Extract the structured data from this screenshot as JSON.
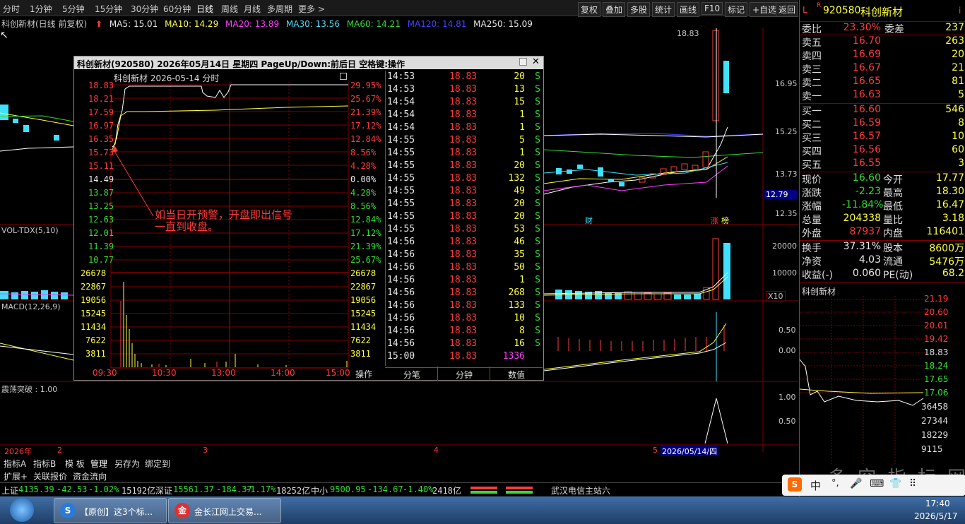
{
  "menu": {
    "periods": [
      "分时",
      "1分钟",
      "5分钟",
      "15分钟",
      "30分钟",
      "60分钟",
      "日线",
      "周线",
      "月线",
      "多周期",
      "更多 >"
    ],
    "right_buttons": [
      "复权",
      "叠加",
      "多股",
      "统计",
      "画线",
      "F10",
      "标记",
      "+自选",
      "返回"
    ]
  },
  "chart_header": {
    "title": "科创新材(日线 前复权)",
    "ma": [
      {
        "label": "MA5: 15.01",
        "color": "#ffffff"
      },
      {
        "label": "MA10: 14.29",
        "color": "#ffff40"
      },
      {
        "label": "MA20: 13.89",
        "color": "#ff40ff"
      },
      {
        "label": "MA30: 13.56",
        "color": "#40e0ff"
      },
      {
        "label": "MA60: 14.21",
        "color": "#33dd33"
      },
      {
        "label": "MA120: 14.81",
        "color": "#4444ff"
      },
      {
        "label": "MA250: 15.09",
        "color": "#ffffff"
      }
    ]
  },
  "kline": {
    "high_label": "18.83",
    "y_labels": [
      "16.95",
      "15.25",
      "13.73",
      "12.35"
    ],
    "current_price_tag": "12.79",
    "marker_cai": "财",
    "marker_zhangting": "涨",
    "marker_bang": "榜"
  },
  "vol_panel": {
    "title": "VOL-TDX(5,10)",
    "y_labels": [
      "20000",
      "10000"
    ],
    "unit": "X10"
  },
  "macd_panel": {
    "title": "MACD(12,26,9)",
    "y_labels": [
      "0.50",
      "0.00"
    ]
  },
  "osc_panel": {
    "title": "震荡突破 : 1.00",
    "y_labels": [
      "1.00",
      "0.50"
    ]
  },
  "timeline": {
    "year": "2026年",
    "months": [
      "2",
      "3",
      "4",
      "5"
    ],
    "date_tag": "2026/05/14/四"
  },
  "popup": {
    "title": "科创新材(920580)  2026年05月14日 星期四 PageUp/Down:前后日 空格键:操作",
    "sub_title": "科创新材  2026-05-14 分时",
    "prices": [
      "18.83",
      "18.21",
      "17.59",
      "16.97",
      "16.35",
      "15.73",
      "15.11",
      "14.49",
      "13.87",
      "13.25",
      "12.63",
      "12.01",
      "11.39",
      "10.77"
    ],
    "pcts": [
      "29.95%",
      "25.67%",
      "21.39%",
      "17.12%",
      "12.84%",
      "8.56%",
      "4.28%",
      "0.00%",
      "4.28%",
      "8.56%",
      "12.84%",
      "17.12%",
      "21.39%",
      "25.67%"
    ],
    "vols": [
      "26678",
      "22867",
      "19056",
      "15245",
      "11434",
      "7622",
      "3811"
    ],
    "times": [
      "09:30",
      "10:30",
      "13:00",
      "14:00",
      "15:00"
    ],
    "op_label": "操作",
    "annotation": "如当日开预警，开盘即出信号\n一直到收盘。",
    "ticks": [
      {
        "t": "14:53",
        "p": "18.83",
        "v": "20",
        "s": "S"
      },
      {
        "t": "14:53",
        "p": "18.83",
        "v": "13",
        "s": "S"
      },
      {
        "t": "14:54",
        "p": "18.83",
        "v": "15",
        "s": "S"
      },
      {
        "t": "14:54",
        "p": "18.83",
        "v": "1",
        "s": "S"
      },
      {
        "t": "14:54",
        "p": "18.83",
        "v": "1",
        "s": "S"
      },
      {
        "t": "14:55",
        "p": "18.83",
        "v": "5",
        "s": "S"
      },
      {
        "t": "14:55",
        "p": "18.83",
        "v": "1",
        "s": "S"
      },
      {
        "t": "14:55",
        "p": "18.83",
        "v": "20",
        "s": "S"
      },
      {
        "t": "14:55",
        "p": "18.83",
        "v": "132",
        "s": "S"
      },
      {
        "t": "14:55",
        "p": "18.83",
        "v": "49",
        "s": "S"
      },
      {
        "t": "14:55",
        "p": "18.83",
        "v": "20",
        "s": "S"
      },
      {
        "t": "14:55",
        "p": "18.83",
        "v": "20",
        "s": "S"
      },
      {
        "t": "14:55",
        "p": "18.83",
        "v": "53",
        "s": "S"
      },
      {
        "t": "14:56",
        "p": "18.83",
        "v": "46",
        "s": "S"
      },
      {
        "t": "14:56",
        "p": "18.83",
        "v": "35",
        "s": "S"
      },
      {
        "t": "14:56",
        "p": "18.83",
        "v": "50",
        "s": "S"
      },
      {
        "t": "14:56",
        "p": "18.83",
        "v": "1",
        "s": "S"
      },
      {
        "t": "14:56",
        "p": "18.83",
        "v": "268",
        "s": "S"
      },
      {
        "t": "14:56",
        "p": "18.83",
        "v": "133",
        "s": "S"
      },
      {
        "t": "14:56",
        "p": "18.83",
        "v": "10",
        "s": "S"
      },
      {
        "t": "14:56",
        "p": "18.83",
        "v": "8",
        "s": "S"
      },
      {
        "t": "14:56",
        "p": "18.83",
        "v": "16",
        "s": "S"
      },
      {
        "t": "15:00",
        "p": "18.83",
        "v": "1336",
        "s": ""
      }
    ],
    "tabs": [
      "分笔",
      "分钟",
      "数值"
    ]
  },
  "quote": {
    "code": "920580",
    "name": "科创新材",
    "weibi_label": "委比",
    "weibi": "23.30%",
    "weicha_label": "委差",
    "weicha": "237",
    "asks": [
      {
        "label": "卖五",
        "price": "16.70",
        "vol": "263"
      },
      {
        "label": "卖四",
        "price": "16.69",
        "vol": "20"
      },
      {
        "label": "卖三",
        "price": "16.67",
        "vol": "21"
      },
      {
        "label": "卖二",
        "price": "16.65",
        "vol": "81"
      },
      {
        "label": "卖一",
        "price": "16.63",
        "vol": "5"
      }
    ],
    "bids": [
      {
        "label": "买一",
        "price": "16.60",
        "vol": "546"
      },
      {
        "label": "买二",
        "price": "16.59",
        "vol": "8"
      },
      {
        "label": "买三",
        "price": "16.57",
        "vol": "10"
      },
      {
        "label": "买四",
        "price": "16.56",
        "vol": "60"
      },
      {
        "label": "买五",
        "price": "16.55",
        "vol": "3"
      }
    ],
    "stats": [
      {
        "l1": "现价",
        "v1": "16.60",
        "l2": "今开",
        "v2": "17.77"
      },
      {
        "l1": "涨跌",
        "v1": "-2.23",
        "l2": "最高",
        "v2": "18.30"
      },
      {
        "l1": "涨幅",
        "v1": "-11.84%",
        "l2": "最低",
        "v2": "16.47"
      },
      {
        "l1": "总量",
        "v1": "204338",
        "l2": "量比",
        "v2": "3.18"
      },
      {
        "l1": "外盘",
        "v1": "87937",
        "l2": "内盘",
        "v2": "116401"
      }
    ],
    "stats2": [
      {
        "l1": "换手",
        "v1": "37.31%",
        "l2": "股本",
        "v2": "8600万"
      },
      {
        "l1": "净资",
        "v1": "4.03",
        "l2": "流通",
        "v2": "5476万"
      },
      {
        "l1": "收益(-)",
        "v1": "0.060",
        "l2": "PE(动)",
        "v2": "68.2"
      }
    ],
    "mini_title": "科创新材",
    "mini_prices": [
      "21.19",
      "20.60",
      "20.01",
      "19.42",
      "18.83",
      "18.24",
      "17.65",
      "17.06"
    ],
    "mini_vols": [
      "36458",
      "27344",
      "18229",
      "9115"
    ]
  },
  "bottom_tabs": [
    "指标A",
    "指标B",
    "模 板",
    "管理",
    "另存为",
    "绑定到"
  ],
  "bottom_tabs2": [
    "扩展+",
    "关联报价",
    "资金流向"
  ],
  "status": {
    "sh_label": "上证",
    "sh": "4135.39",
    "sh_chg": "-42.53",
    "sh_pct": "-1.02%",
    "sh_amt": "15192亿",
    "sz_label": "深证",
    "sz": "15561.37",
    "sz_chg": "-184.37",
    "sz_pct": "-1.17%",
    "sz_amt": "18252亿",
    "zx_label": "中小",
    "zx": "9500.95",
    "zx_chg": "-134.67",
    "zx_pct": "-1.40%",
    "zx_amt": "2418亿",
    "server": "武汉电信主站六"
  },
  "taskbar": {
    "items": [
      "【原创】这3个标...",
      "金长江网上交易..."
    ],
    "ime": [
      "中",
      "°,",
      "🎤",
      "⌨",
      "👕",
      "⠿"
    ],
    "time": "17:40",
    "date": "2026/5/17"
  },
  "watermark": "多 空 指 标 网"
}
